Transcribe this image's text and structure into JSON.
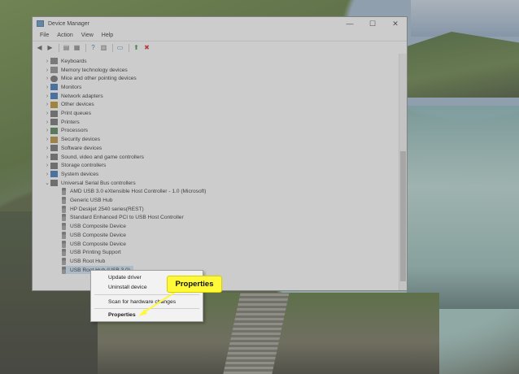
{
  "window": {
    "title": "Device Manager",
    "controls": [
      "—",
      "☐",
      "✕"
    ]
  },
  "menubar": [
    "File",
    "Action",
    "View",
    "Help"
  ],
  "tree": {
    "categories": [
      {
        "label": "Keyboards",
        "icon": "keyboard-icon",
        "color": "#5a5a5a"
      },
      {
        "label": "Memory technology devices",
        "icon": "memory-icon",
        "color": "#7a7a7a"
      },
      {
        "label": "Mice and other pointing devices",
        "icon": "mouse-icon",
        "color": "#6a6a6a"
      },
      {
        "label": "Monitors",
        "icon": "monitor-icon",
        "color": "#2f6fb3"
      },
      {
        "label": "Network adapters",
        "icon": "network-icon",
        "color": "#2f6fb3"
      },
      {
        "label": "Other devices",
        "icon": "unknown-device-icon",
        "color": "#b88a1a"
      },
      {
        "label": "Print queues",
        "icon": "printer-icon",
        "color": "#6a6a6a"
      },
      {
        "label": "Printers",
        "icon": "printer-icon",
        "color": "#6a6a6a"
      },
      {
        "label": "Processors",
        "icon": "processor-icon",
        "color": "#4a7a4a"
      },
      {
        "label": "Security devices",
        "icon": "security-icon",
        "color": "#b08a30"
      },
      {
        "label": "Software devices",
        "icon": "software-device-icon",
        "color": "#6a6a6a"
      },
      {
        "label": "Sound, video and game controllers",
        "icon": "speaker-icon",
        "color": "#6a6a6a"
      },
      {
        "label": "Storage controllers",
        "icon": "storage-icon",
        "color": "#6a6a6a"
      },
      {
        "label": "System devices",
        "icon": "computer-icon",
        "color": "#2f6fb3"
      },
      {
        "label": "Universal Serial Bus controllers",
        "icon": "usb-icon",
        "color": "#6a6a6a"
      }
    ],
    "usb_children": [
      "AMD USB 3.0 eXtensible Host Controller - 1.0 (Microsoft)",
      "Generic USB Hub",
      "HP Deskjet 2540 series(REST)",
      "Standard Enhanced PCI to USB Host Controller",
      "USB Composite Device",
      "USB Composite Device",
      "USB Composite Device",
      "USB Printing Support",
      "USB Root Hub",
      "USB Root Hub (USB 3.0)"
    ]
  },
  "context_menu": {
    "items": [
      "Update driver",
      "Uninstall device",
      "Scan for hardware changes",
      "Properties"
    ]
  },
  "callout": {
    "label": "Properties",
    "color": "#fff93a"
  }
}
